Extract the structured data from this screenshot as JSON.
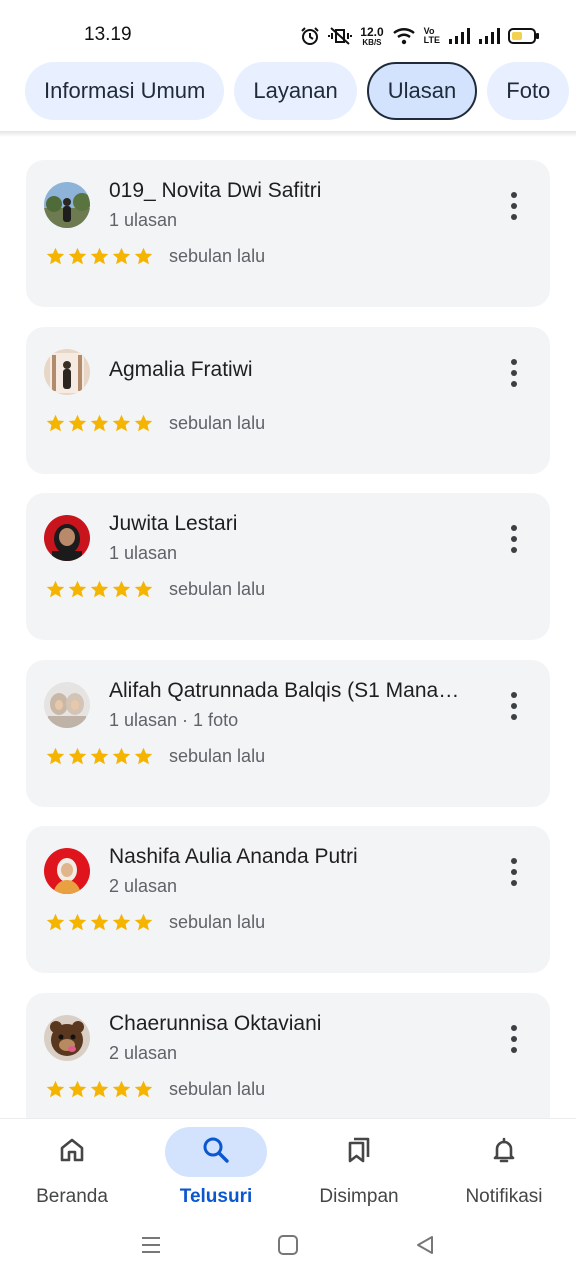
{
  "status": {
    "time": "13.19",
    "net_speed_value": "12.0",
    "net_speed_unit": "KB/S",
    "volte_top": "Vo",
    "volte_bottom": "LTE"
  },
  "tabs": [
    {
      "label": "Informasi Umum",
      "active": false
    },
    {
      "label": "Layanan",
      "active": false
    },
    {
      "label": "Ulasan",
      "active": true
    },
    {
      "label": "Foto",
      "active": false
    }
  ],
  "reviews": [
    {
      "name": "019_ Novita Dwi Safitri",
      "meta": "1 ulasan",
      "stars": 5,
      "time": "sebulan lalu"
    },
    {
      "name": "Agmalia Fratiwi",
      "meta": "",
      "stars": 5,
      "time": "sebulan lalu"
    },
    {
      "name": "Juwita Lestari",
      "meta": "1 ulasan",
      "stars": 5,
      "time": "sebulan lalu"
    },
    {
      "name": "Alifah Qatrunnada Balqis (S1 Mana…",
      "meta": "1 ulasan · 1 foto",
      "stars": 5,
      "time": "sebulan lalu"
    },
    {
      "name": "Nashifa Aulia Ananda Putri",
      "meta": "2 ulasan",
      "stars": 5,
      "time": "sebulan lalu"
    },
    {
      "name": "Chaerunnisa Oktaviani",
      "meta": "2 ulasan",
      "stars": 5,
      "time": "sebulan lalu"
    }
  ],
  "bottom_nav": [
    {
      "label": "Beranda",
      "icon": "home-icon",
      "active": false
    },
    {
      "label": "Telusuri",
      "icon": "search-icon",
      "active": true
    },
    {
      "label": "Disimpan",
      "icon": "bookmarks-icon",
      "active": false
    },
    {
      "label": "Notifikasi",
      "icon": "bell-icon",
      "active": false
    }
  ],
  "colors": {
    "star": "#f5b400",
    "accent": "#0b57d0",
    "active_pill": "#d3e3fd",
    "card_bg": "#f3f4f6"
  }
}
